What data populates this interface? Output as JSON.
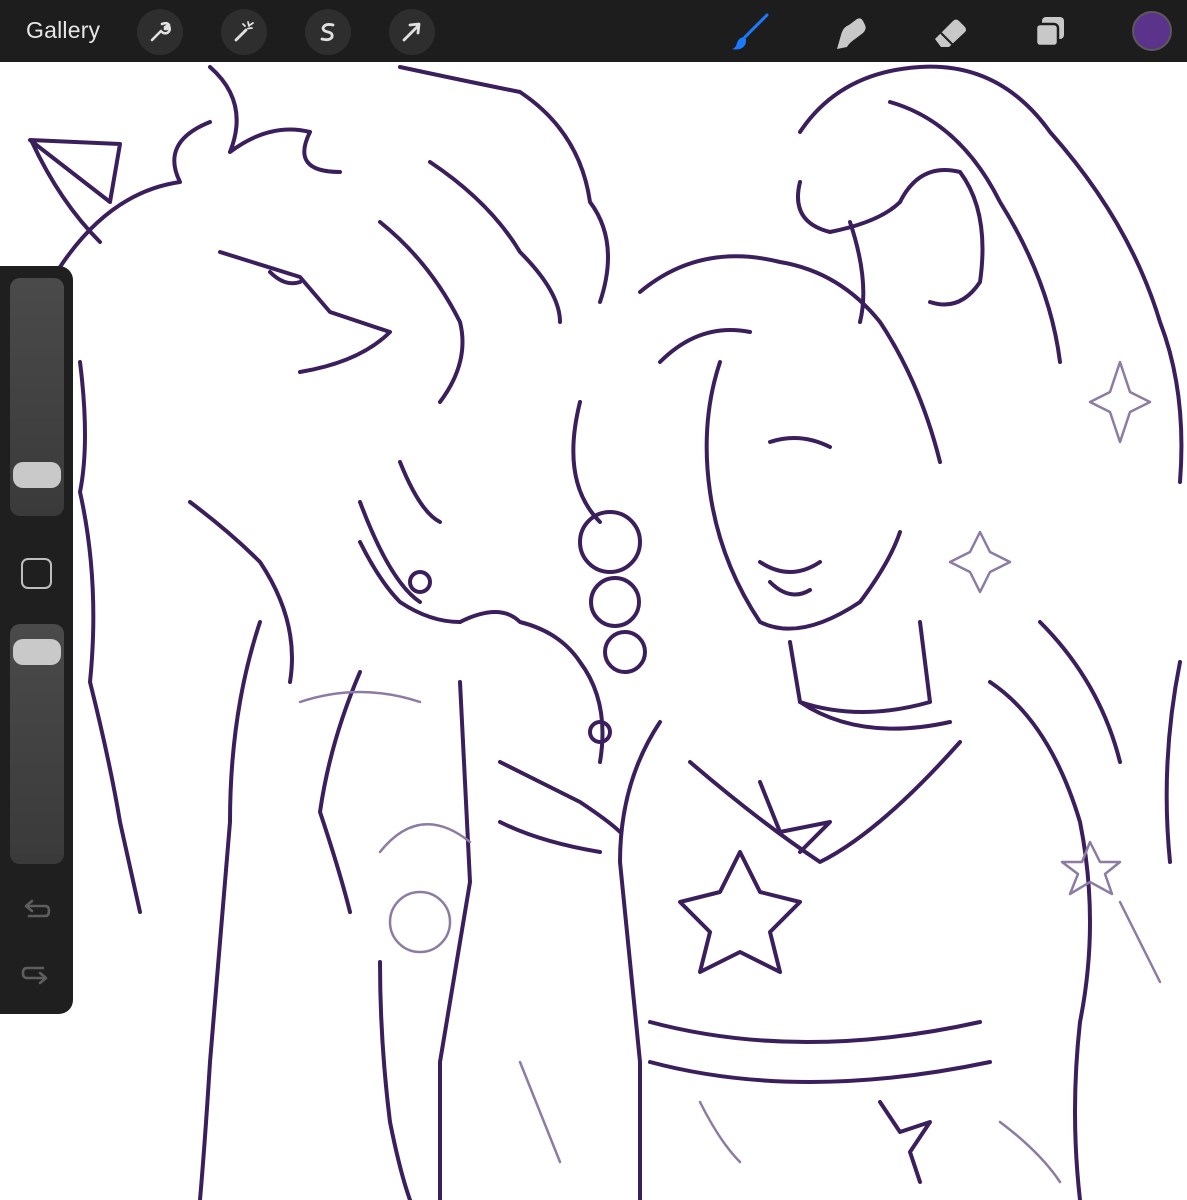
{
  "app": {
    "gallery_label": "Gallery",
    "accent_color": "#1a7bff",
    "current_color": "#5b338a",
    "stroke_color": "#3b1f5c"
  },
  "toolbar": {
    "left_tools": [
      {
        "name": "actions",
        "icon": "wrench-icon"
      },
      {
        "name": "adjustments",
        "icon": "magic-wand-icon"
      },
      {
        "name": "selection",
        "icon": "selection-s-icon"
      },
      {
        "name": "transform",
        "icon": "arrow-cursor-icon"
      }
    ],
    "right_tools": [
      {
        "name": "brush",
        "icon": "brush-icon",
        "active": true
      },
      {
        "name": "smudge",
        "icon": "smudge-finger-icon",
        "active": false
      },
      {
        "name": "eraser",
        "icon": "eraser-icon",
        "active": false
      },
      {
        "name": "layers",
        "icon": "layers-icon",
        "active": false
      }
    ]
  },
  "sidebar": {
    "brush_size_level": 0.12,
    "brush_opacity_level": 0.94,
    "modify_icon": "square-icon",
    "undo_icon": "undo-arrow-icon",
    "redo_icon": "redo-arrow-icon"
  }
}
